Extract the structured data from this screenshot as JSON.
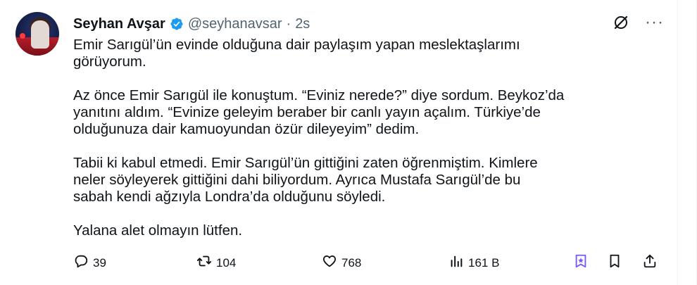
{
  "tweet": {
    "author_name": "Seyhan Avşar",
    "handle": "@seyhanavsar",
    "separator": "·",
    "time": "2s",
    "more_label": "···",
    "paragraphs": [
      "Emir Sarıgül’ün evinde olduğuna dair paylaşım yapan meslektaşlarımı\ngörüyorum.",
      "Az önce Emir Sarıgül ile konuştum. “Eviniz nerede?” diye sordum. Beykoz’da\nyanıtını aldım. “Evinize geleyim beraber bir canlı yayın açalım. Türkiye’de\nolduğunuza dair kamuoyundan özür dileyeyim” dedim.",
      "Tabii ki kabul etmedi. Emir Sarıgül’ün gittiğini zaten öğrenmiştim. Kimlere\nneler söyleyerek gittiğini dahi biliyordum. Ayrıca Mustafa Sarıgül’de bu\nsabah kendi ağzıyla Londra’da olduğunu söyledi.",
      "Yalana alet olmayın lütfen."
    ],
    "actions": {
      "reply_count": "39",
      "retweet_count": "104",
      "like_count": "768",
      "views_count": "161 B"
    }
  },
  "icons": {
    "verified": "verified-badge-icon",
    "grok": "grok-icon",
    "more": "more-icon",
    "reply": "reply-icon",
    "retweet": "retweet-icon",
    "like": "like-icon",
    "views": "views-icon",
    "grok_action": "grok-action-icon",
    "bookmark": "bookmark-icon",
    "share": "share-icon"
  },
  "colors": {
    "text": "#0f1419",
    "secondary": "#536471",
    "verified": "#1d9bf0",
    "grok_accent": "#7856ff"
  }
}
